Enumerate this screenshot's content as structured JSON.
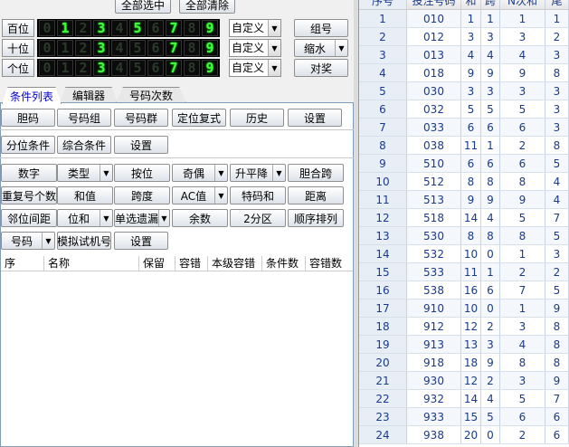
{
  "top_buttons": {
    "select_all": "全部选中",
    "clear_all": "全部清除"
  },
  "digit_rows": [
    {
      "label": "百位",
      "on": [
        1,
        3,
        5,
        7,
        9
      ],
      "mode": "自定义"
    },
    {
      "label": "十位",
      "on": [
        3,
        7,
        9
      ],
      "mode": "自定义"
    },
    {
      "label": "个位",
      "on": [
        3,
        7,
        9
      ],
      "mode": "自定义"
    }
  ],
  "digits": [
    "0",
    "1",
    "2",
    "3",
    "4",
    "5",
    "6",
    "7",
    "8",
    "9"
  ],
  "right_buttons": {
    "group": "组号",
    "shrink": "缩水",
    "prize": "对奖"
  },
  "tabs": [
    "条件列表",
    "编辑器",
    "号码次数"
  ],
  "row1": [
    "胆码",
    "号码组",
    "号码群",
    "定位复式",
    "历史",
    "设置"
  ],
  "row2": [
    "分位条件",
    "综合条件",
    "设置"
  ],
  "row3": [
    "数字",
    "类型",
    "按位",
    "奇偶",
    "升平降",
    "胆合跨"
  ],
  "row4": [
    "重复号个数",
    "和值",
    "跨度",
    "AC值",
    "特码和",
    "距离"
  ],
  "row5": [
    "邻位间距",
    "位和",
    "单选遗漏",
    "余数",
    "2分区",
    "顺序排列"
  ],
  "row6": [
    "号码",
    "模拟试机号",
    "设置"
  ],
  "list_headers": [
    "序",
    "名称",
    "保留",
    "容错",
    "本级容错",
    "条件数",
    "容错数"
  ],
  "grid_headers": [
    "序号",
    "投注号码",
    "和",
    "跨",
    "N次和",
    "尾"
  ],
  "grid_rows": [
    [
      "1",
      "010",
      "1",
      "1",
      "1",
      "1"
    ],
    [
      "2",
      "012",
      "3",
      "3",
      "3",
      "2"
    ],
    [
      "3",
      "013",
      "4",
      "4",
      "4",
      "3"
    ],
    [
      "4",
      "018",
      "9",
      "9",
      "9",
      "8"
    ],
    [
      "5",
      "030",
      "3",
      "3",
      "3",
      "3"
    ],
    [
      "6",
      "032",
      "5",
      "5",
      "5",
      "3"
    ],
    [
      "7",
      "033",
      "6",
      "6",
      "6",
      "3"
    ],
    [
      "8",
      "038",
      "11",
      "1",
      "2",
      "8"
    ],
    [
      "9",
      "510",
      "6",
      "6",
      "6",
      "5"
    ],
    [
      "10",
      "512",
      "8",
      "8",
      "8",
      "4"
    ],
    [
      "11",
      "513",
      "9",
      "9",
      "9",
      "4"
    ],
    [
      "12",
      "518",
      "14",
      "4",
      "5",
      "7"
    ],
    [
      "13",
      "530",
      "8",
      "8",
      "8",
      "5"
    ],
    [
      "14",
      "532",
      "10",
      "0",
      "1",
      "3"
    ],
    [
      "15",
      "533",
      "11",
      "1",
      "2",
      "2"
    ],
    [
      "16",
      "538",
      "16",
      "6",
      "7",
      "5"
    ],
    [
      "17",
      "910",
      "10",
      "0",
      "1",
      "9"
    ],
    [
      "18",
      "912",
      "12",
      "2",
      "3",
      "8"
    ],
    [
      "19",
      "913",
      "13",
      "3",
      "4",
      "8"
    ],
    [
      "20",
      "918",
      "18",
      "9",
      "8",
      "8"
    ],
    [
      "21",
      "930",
      "12",
      "2",
      "3",
      "9"
    ],
    [
      "22",
      "932",
      "14",
      "4",
      "5",
      "7"
    ],
    [
      "23",
      "933",
      "15",
      "5",
      "6",
      "6"
    ],
    [
      "24",
      "938",
      "20",
      "0",
      "2",
      "6"
    ]
  ]
}
